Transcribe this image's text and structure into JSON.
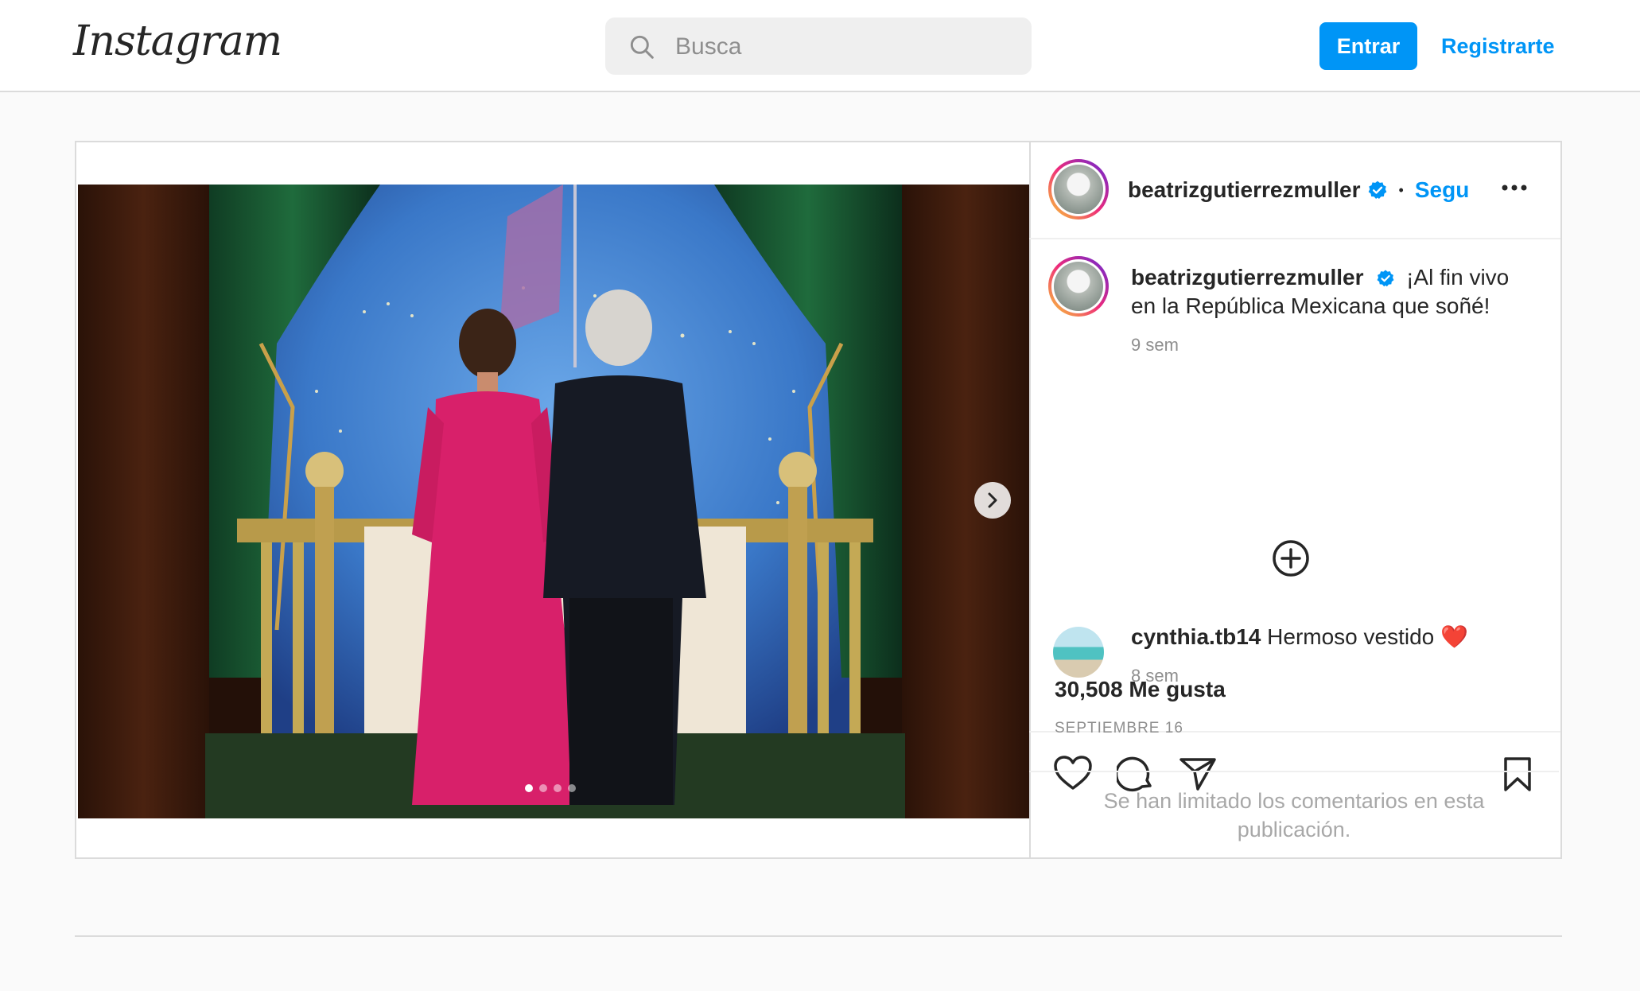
{
  "nav": {
    "logo": "Instagram",
    "search_placeholder": "Busca",
    "login_label": "Entrar",
    "register_label": "Registrarte"
  },
  "post": {
    "author": "beatrizgutierrezmuller",
    "follow_label": "Segu",
    "separator": "•",
    "caption": "¡Al fin vivo en la República Mexicana que soñé!",
    "caption_time": "9 sem",
    "comments": [
      {
        "user": "cynthia.tb14",
        "text": "Hermoso vestido",
        "emoji": "❤️",
        "time": "8 sem"
      }
    ],
    "likes": "30,508 Me gusta",
    "date": "SEPTIEMBRE 16",
    "comments_limited": "Se han limitado los comentarios en esta publicación.",
    "carousel": {
      "count": 4,
      "active_index": 0
    }
  },
  "colors": {
    "accent": "#0095f6",
    "text": "#262626",
    "muted": "#8e8e8e",
    "border": "#dbdbdb",
    "background": "#fafafa"
  },
  "icons": [
    "instagram-logo",
    "search-icon",
    "verified-badge-icon",
    "more-options-icon",
    "add-comment-icon",
    "heart-icon",
    "comment-icon",
    "share-icon",
    "bookmark-icon",
    "chevron-right-icon"
  ]
}
